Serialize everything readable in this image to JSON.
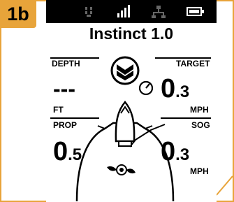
{
  "figure": {
    "step_badge": "1b",
    "badge_color": "#e8a43a"
  },
  "screen": {
    "status_icons": [
      "signal-bars-icon",
      "network-icon",
      "battery-icon",
      "gps-icon"
    ],
    "title": "Instinct 1.0",
    "depth": {
      "label": "DEPTH",
      "value": "---",
      "unit": "FT"
    },
    "target": {
      "label": "TARGET",
      "value_int": "0",
      "value_dec": ".3",
      "unit": "MPH"
    },
    "prop": {
      "label": "PROP",
      "value_int": "0",
      "value_dec": ".5"
    },
    "sog": {
      "label": "SOG",
      "value_int": "0",
      "value_dec": ".3",
      "unit": "MPH"
    }
  }
}
